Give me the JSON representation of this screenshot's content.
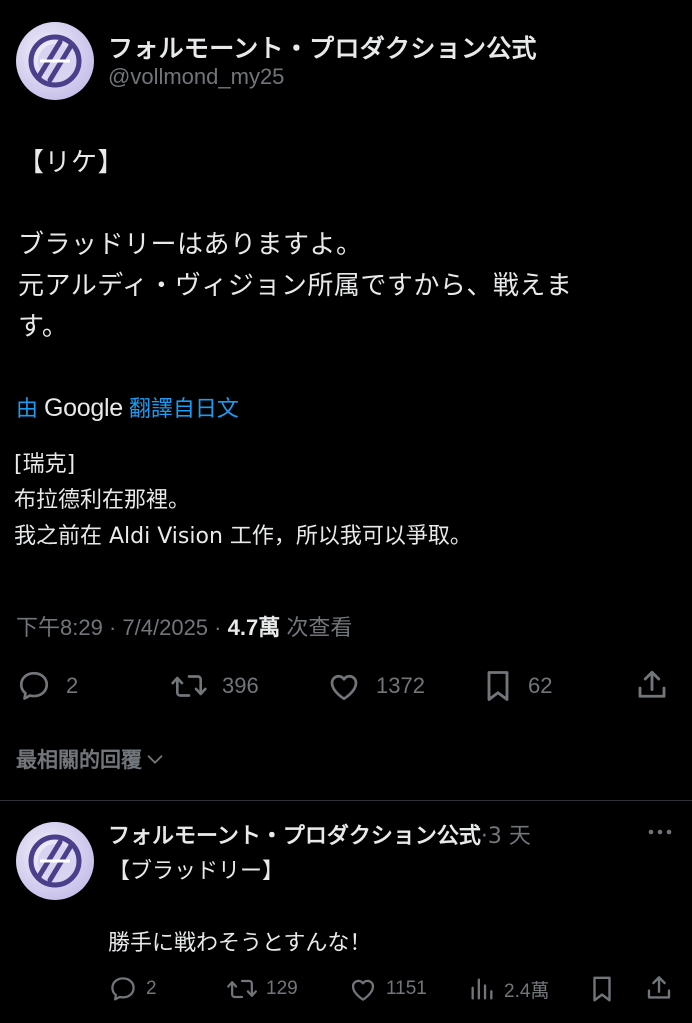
{
  "post": {
    "author": {
      "display_name": "フォルモーント・プロダクション公式",
      "handle": "@vollmond_my25"
    },
    "original_text": "【リケ】\n\nブラッドリーはありますよ。\n元アルディ・ヴィジョン所属ですから、戦えま\nす。",
    "translation": {
      "prefix": "由",
      "brand": "Google",
      "suffix": "翻譯自日文",
      "text": "[瑞克]\n布拉德利在那裡。\n我之前在 Aldi Vision 工作，所以我可以爭取。"
    },
    "meta": {
      "time": "下午8:29",
      "separator": "·",
      "date": "7/4/2025",
      "views": "4.7萬",
      "views_label": "次查看"
    },
    "actions": {
      "replies": "2",
      "reposts": "396",
      "likes": "1372",
      "bookmarks": "62"
    }
  },
  "replies_sort": {
    "label": "最相關的回覆"
  },
  "reply": {
    "author": {
      "display_name": "フォルモーント・プロダクション公式",
      "time": "·3 天"
    },
    "text": "【ブラッドリー】\n\n勝手に戦わそうとすんな！",
    "actions": {
      "replies": "2",
      "reposts": "129",
      "likes": "1151",
      "views": "2.4萬"
    }
  },
  "icons": {
    "reply": "speech-bubble-icon",
    "repost": "repost-arrows-icon",
    "like": "heart-icon",
    "bookmark": "bookmark-icon",
    "share": "share-upload-icon",
    "views": "bar-chart-icon",
    "more": "more-dots-icon",
    "chevron": "chevron-down-icon"
  },
  "colors": {
    "background": "#000000",
    "text_primary": "#e7e9ea",
    "text_secondary": "#71767b",
    "link": "#1d9bf0",
    "divider": "#2f3336"
  }
}
